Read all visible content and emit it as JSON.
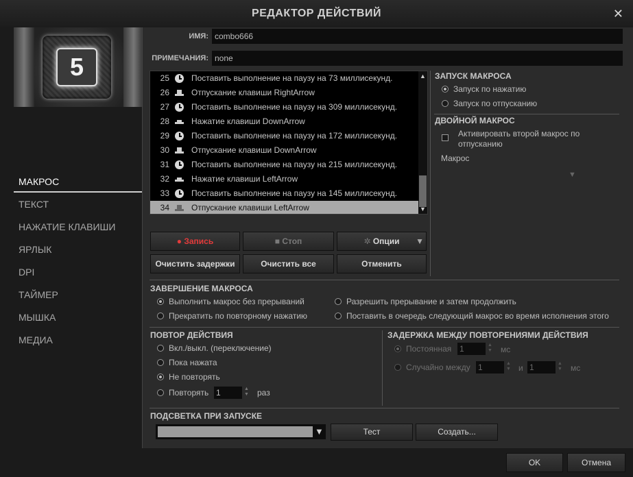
{
  "window": {
    "title": "РЕДАКТОР ДЕЙСТВИЙ",
    "close_glyph": "✕"
  },
  "key_image": {
    "label": "5"
  },
  "nav": {
    "items": [
      {
        "id": "macro",
        "label": "МАКРОС",
        "active": true
      },
      {
        "id": "text",
        "label": "ТЕКСТ"
      },
      {
        "id": "keypress",
        "label": "НАЖАТИЕ КЛАВИШИ"
      },
      {
        "id": "shortcut",
        "label": "ЯРЛЫК"
      },
      {
        "id": "dpi",
        "label": "DPI"
      },
      {
        "id": "timer",
        "label": "ТАЙМЕР"
      },
      {
        "id": "mouse",
        "label": "МЫШКА"
      },
      {
        "id": "media",
        "label": "МЕДИА"
      }
    ]
  },
  "form": {
    "name_label": "ИМЯ:",
    "name_value": "combo666",
    "notes_label": "ПРИМЕЧАНИЯ:",
    "notes_value": "none"
  },
  "actions": [
    {
      "n": "25",
      "icon": "clock-icon",
      "text": "Поставить выполнение на паузу на 73 миллисекунд."
    },
    {
      "n": "26",
      "icon": "key-release-icon",
      "text": "Отпускание клавиши RightArrow"
    },
    {
      "n": "27",
      "icon": "clock-icon",
      "text": "Поставить выполнение на паузу на 309 миллисекунд."
    },
    {
      "n": "28",
      "icon": "key-press-icon",
      "text": "Нажатие клавиши DownArrow"
    },
    {
      "n": "29",
      "icon": "clock-icon",
      "text": "Поставить выполнение на паузу на 172 миллисекунд."
    },
    {
      "n": "30",
      "icon": "key-release-icon",
      "text": "Отпускание клавиши DownArrow"
    },
    {
      "n": "31",
      "icon": "clock-icon",
      "text": "Поставить выполнение на паузу на 215 миллисекунд."
    },
    {
      "n": "32",
      "icon": "key-press-icon",
      "text": "Нажатие клавиши LeftArrow"
    },
    {
      "n": "33",
      "icon": "clock-icon",
      "text": "Поставить выполнение на паузу на 145 миллисекунд."
    },
    {
      "n": "34",
      "icon": "key-release-icon",
      "text": "Отпускание клавиши LeftArrow",
      "selected": true
    }
  ],
  "toolbar": {
    "record": "Запись",
    "stop": "Стоп",
    "options": "Опции",
    "clear_delays": "Очистить задержки",
    "clear_all": "Очистить все",
    "undo": "Отменить"
  },
  "launch": {
    "title": "ЗАПУСК МАКРОСА",
    "on_press": "Запуск по нажатию",
    "on_release": "Запуск по отпусканию",
    "selected": "on_press"
  },
  "double": {
    "title": "ДВОЙНОЙ МАКРОС",
    "activate": "Активировать второй макрос по отпусканию",
    "macro_label": "Макрос"
  },
  "completion": {
    "title": "ЗАВЕРШЕНИЕ МАКРОСА",
    "opt1": "Выполнить макрос без прерываний",
    "opt2": "Разрешить прерывание и затем продолжить",
    "opt3": "Прекратить по повторному нажатию",
    "opt4": "Поставить в очередь следующий макрос во время исполнения этого",
    "selected": "opt1"
  },
  "repeat": {
    "title": "ПОВТОР ДЕЙСТВИЯ",
    "toggle": "Вкл./выкл. (переключение)",
    "while_held": "Пока нажата",
    "no_repeat": "Не повторять",
    "repeat_n": "Повторять",
    "count": "1",
    "times": "раз",
    "selected": "no_repeat"
  },
  "delay": {
    "title": "ЗАДЕРЖКА МЕЖДУ ПОВТОРЕНИЯМИ ДЕЙСТВИЯ",
    "constant": "Постоянная",
    "constant_value": "1",
    "ms": "мс",
    "random": "Случайно между",
    "random_min": "1",
    "and": "и",
    "random_max": "1",
    "ms2": "мс"
  },
  "lighting": {
    "title": "ПОДСВЕТКА ПРИ ЗАПУСКЕ",
    "test": "Тест",
    "create": "Создать..."
  },
  "footer": {
    "ok": "OK",
    "cancel": "Отмена"
  }
}
